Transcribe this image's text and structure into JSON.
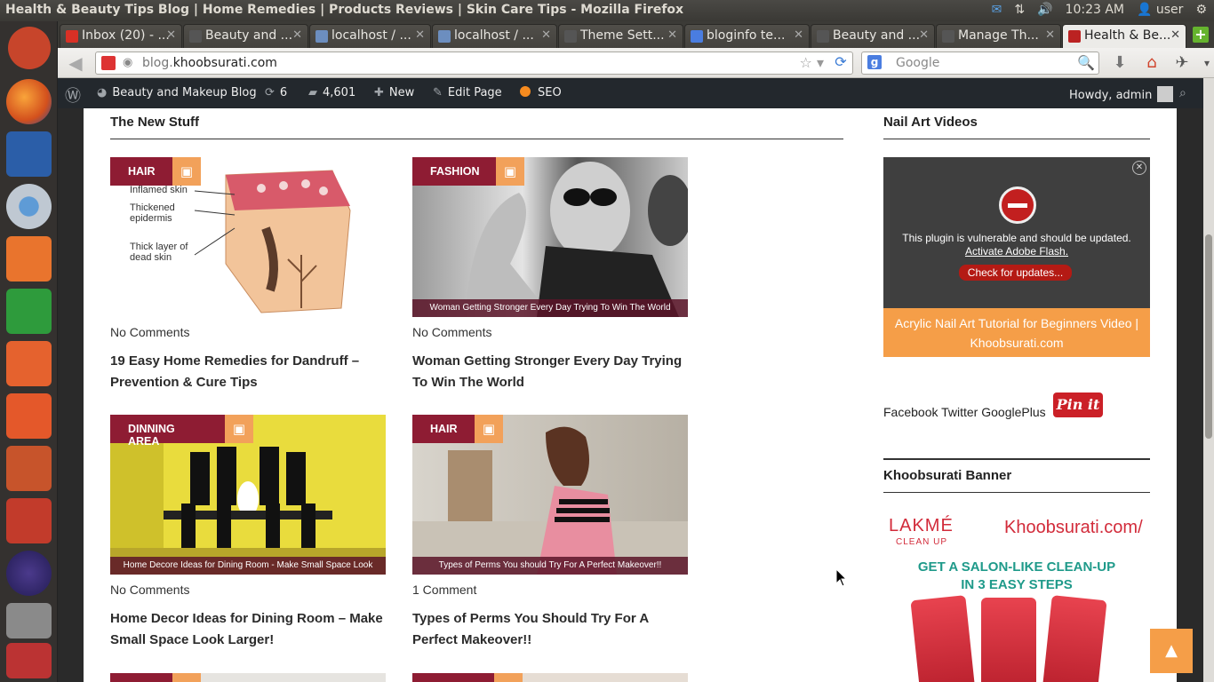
{
  "system": {
    "window_title": "Health & Beauty Tips Blog | Home Remedies | Products Reviews | Skin Care Tips - Mozilla Firefox",
    "time": "10:23 AM",
    "user": "user"
  },
  "tabs": [
    {
      "label": "Inbox (20) - ...",
      "fav_color": "#d93025"
    },
    {
      "label": "Beauty and ...",
      "fav_color": "#555"
    },
    {
      "label": "localhost / ...",
      "fav_color": "#6c8ebf"
    },
    {
      "label": "localhost / ...",
      "fav_color": "#6c8ebf"
    },
    {
      "label": "Theme Sett...",
      "fav_color": "#555"
    },
    {
      "label": "bloginfo te...",
      "fav_color": "#4a7de0"
    },
    {
      "label": "Beauty and ...",
      "fav_color": "#555"
    },
    {
      "label": "Manage Th...",
      "fav_color": "#555"
    },
    {
      "label": "Health & Be...",
      "fav_color": "#b22"
    }
  ],
  "nav": {
    "url_host": "blog.",
    "url_domain": "khoobsurati.com",
    "search_placeholder": "Google"
  },
  "adminbar": {
    "site_name": "Beauty and Makeup Blog",
    "updates": "6",
    "comments": "4,601",
    "new_label": "New",
    "edit_label": "Edit Page",
    "seo_label": "SEO",
    "howdy": "Howdy, admin"
  },
  "main": {
    "section_title": "The New Stuff",
    "posts": [
      {
        "category": "HAIR",
        "caption": "",
        "comments": "No Comments",
        "title": "19 Easy Home Remedies for Dandruff – Prevention & Cure Tips"
      },
      {
        "category": "FASHION",
        "caption": "Woman Getting Stronger Every Day Trying To Win The World",
        "comments": "No Comments",
        "title": "Woman Getting Stronger Every Day Trying To Win The World"
      },
      {
        "category": "DINNING AREA",
        "caption": "Home Decore Ideas for Dining Room - Make Small Space Look Larger!",
        "comments": "No Comments",
        "title": "Home Decor Ideas for Dining Room – Make Small Space Look Larger!"
      },
      {
        "category": "HAIR",
        "caption": "Types of Perms You should Try For A Perfect Makeover!!",
        "comments": "1 Comment",
        "title": "Types of Perms You Should Try For A Perfect Makeover!!"
      }
    ],
    "diagram_labels": [
      "Inflamed skin",
      "Thickened epidermis",
      "Thick layer of dead skin"
    ]
  },
  "sidebar": {
    "nail_title": "Nail Art Videos",
    "flash_msg": "This plugin is vulnerable and should be updated.",
    "flash_activate": "Activate Adobe Flash.",
    "flash_update": "Check for updates...",
    "video_caption": "Acrylic Nail Art Tutorial for Beginners Video | Khoobsurati.com",
    "social_text": "Facebook Twitter GooglePlus",
    "pinit": "Pin it",
    "banner_title": "Khoobsurati Banner",
    "banner_brand": "LAKMÉ",
    "banner_cleanup": "CLEAN UP",
    "banner_site": "Khoobsurati.com/",
    "banner_promo_1": "GET A SALON-LIKE CLEAN-UP",
    "banner_promo_2": "IN 3 EASY STEPS"
  }
}
